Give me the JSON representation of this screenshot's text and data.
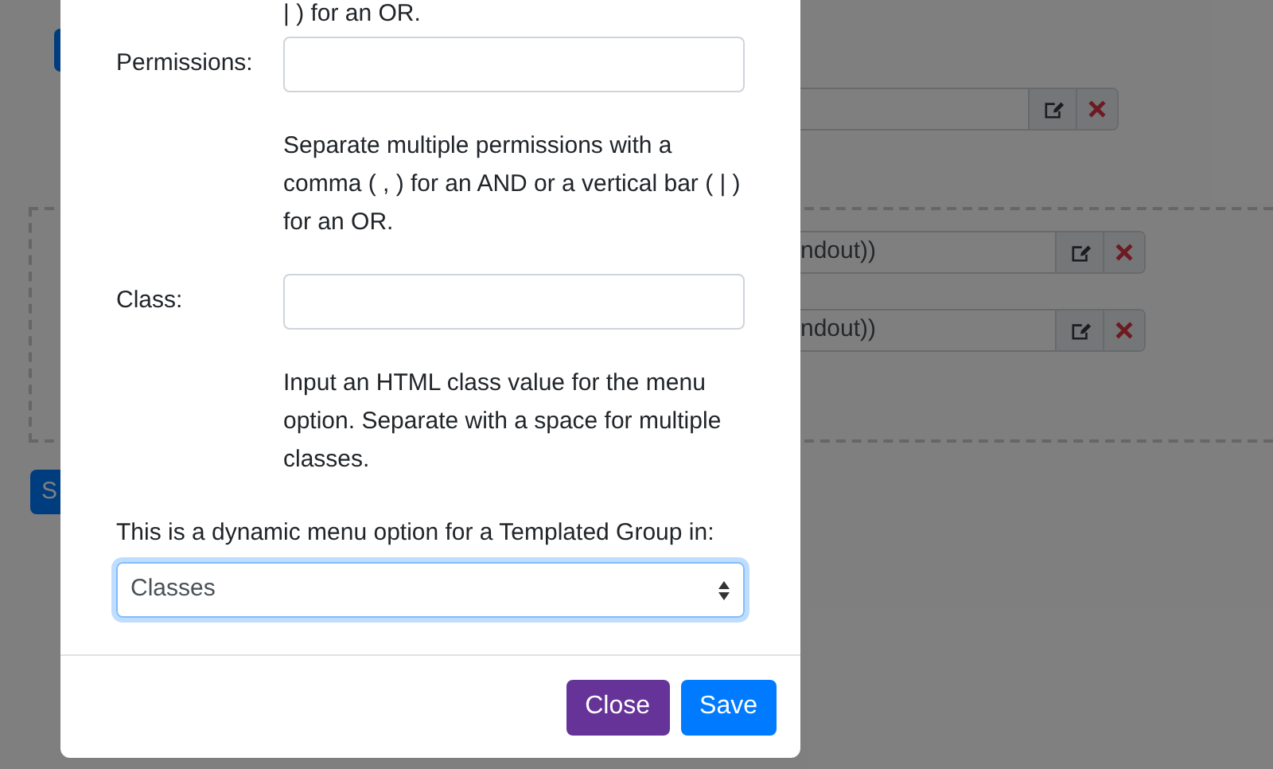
{
  "background": {
    "rows": [
      {
        "text": null
      },
      {
        "text": "ndout))"
      },
      {
        "text": "ndout))"
      }
    ],
    "button": "S"
  },
  "modal": {
    "top_help": "| ) for an OR.",
    "fields": [
      {
        "label": "Permissions:",
        "help": "Separate multiple permissions with a comma ( , ) for an AND or a vertical bar ( | ) for an OR."
      },
      {
        "label": "Class:",
        "help": "Input an HTML class value for the menu option. Separate with a space for multiple classes."
      }
    ],
    "group_prompt": "This is a dynamic menu option for a Templated Group in:",
    "group_select": {
      "value": "Classes",
      "focused": true
    },
    "buttons": [
      {
        "label": "Close",
        "kind": "secondary"
      },
      {
        "label": "Save",
        "kind": "primary"
      }
    ]
  }
}
